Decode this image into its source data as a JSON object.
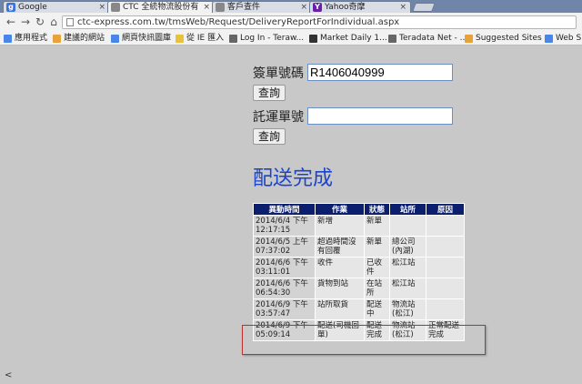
{
  "browser": {
    "tabs": [
      {
        "label": "Google",
        "icon": "google-icon",
        "color": "#3d73d9",
        "glyph": "g",
        "active": false
      },
      {
        "label": "CTC 全統物流股份有",
        "icon": "page-icon",
        "color": "#888888",
        "glyph": "",
        "active": true
      },
      {
        "label": "客戶查件",
        "icon": "page-icon",
        "color": "#888888",
        "glyph": "",
        "active": false
      },
      {
        "label": "Yahoo奇摩",
        "icon": "yahoo-icon",
        "color": "#6a1fa8",
        "glyph": "Y",
        "active": false
      }
    ],
    "url": "ctc-express.com.tw/tmsWeb/Request/DeliveryReportForIndividual.aspx",
    "bookmarks": [
      {
        "label": "應用程式",
        "color": "#4a86e8"
      },
      {
        "label": "建議的網站",
        "color": "#e8a23a"
      },
      {
        "label": "網頁快訊圖庫",
        "color": "#4a86e8"
      },
      {
        "label": "從 IE 匯入",
        "color": "#e8c23a"
      },
      {
        "label": "Log In - Teraw...",
        "color": "#666666"
      },
      {
        "label": "Market Daily 1...",
        "color": "#333333"
      },
      {
        "label": "Teradata Net - ...",
        "color": "#666666"
      },
      {
        "label": "Suggested Sites",
        "color": "#e8a23a"
      },
      {
        "label": "Web S",
        "color": "#4a86e8"
      }
    ]
  },
  "form": {
    "sign_label": "簽單號碼",
    "sign_value": "R1406040999",
    "query_label": "查詢",
    "tracking_label": "託運單號",
    "tracking_value": ""
  },
  "status_title": "配送完成",
  "table": {
    "headers": [
      "異動時間",
      "作業",
      "狀態",
      "站所",
      "原因"
    ],
    "rows": [
      [
        "2014/6/4 下午 12:17:15",
        "新增",
        "新單",
        "",
        ""
      ],
      [
        "2014/6/5 上午 07:37:02",
        "超過時間沒有回覆",
        "新單",
        "總公司(內湖)",
        ""
      ],
      [
        "2014/6/6 下午 03:11:01",
        "收件",
        "已收件",
        "松江站",
        ""
      ],
      [
        "2014/6/6 下午 06:54:30",
        "貨物到站",
        "在站所",
        "松江站",
        ""
      ],
      [
        "2014/6/9 下午 03:57:47",
        "站所取貨",
        "配送中",
        "物流站(松江)",
        ""
      ],
      [
        "2014/6/9 下午 05:09:14",
        "配送(司機回單)",
        "配送完成",
        "物流站(松江)",
        "正常配送完成"
      ]
    ]
  },
  "scroll_glyph": "<"
}
